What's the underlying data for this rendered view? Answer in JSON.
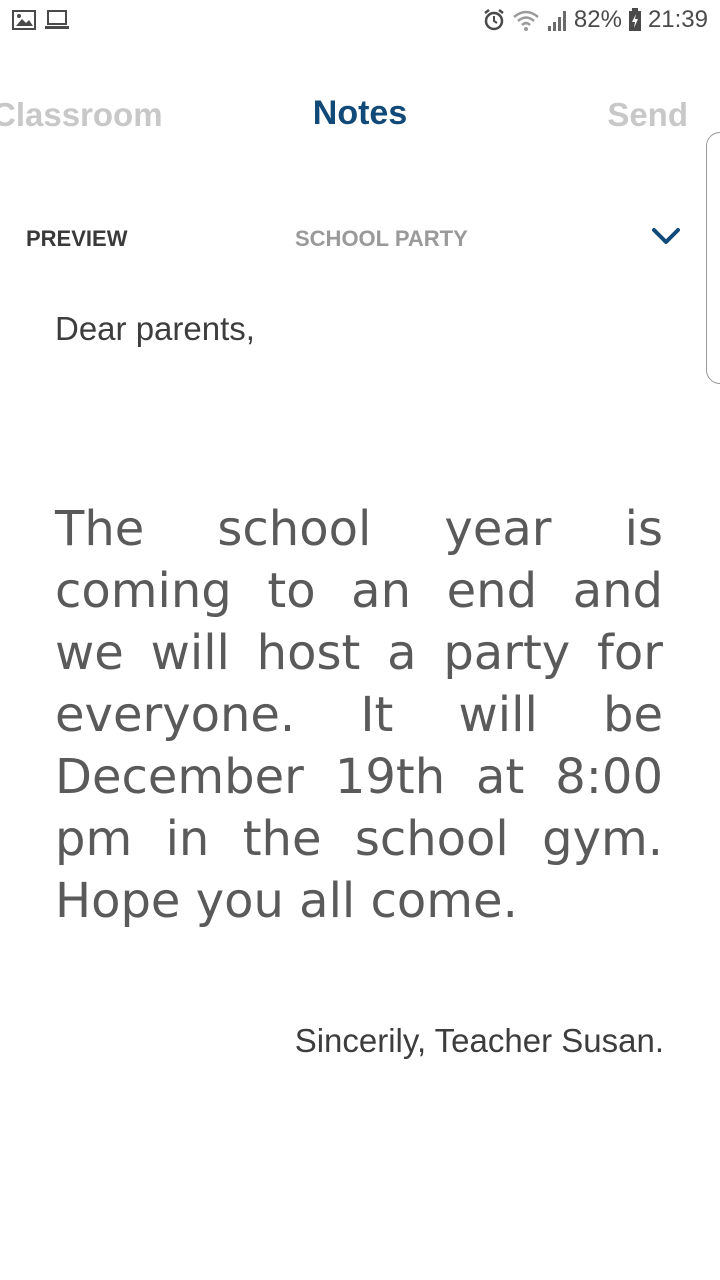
{
  "status_bar": {
    "left_icons": [
      "gallery-icon",
      "laptop-icon"
    ],
    "right_icons": [
      "alarm-icon",
      "wifi-icon",
      "signal-icon"
    ],
    "battery_percent": "82%",
    "time": "21:39",
    "battery_icon": "battery-charging-icon"
  },
  "nav": {
    "back_label": "Classroom",
    "title": "Notes",
    "send_label": "Send"
  },
  "preview": {
    "label": "PREVIEW",
    "topic": "SCHOOL PARTY",
    "topic_icon": "chevron-down-icon"
  },
  "letter": {
    "greeting": "Dear parents,",
    "body": "The school year is coming to an end and we will host a party for everyone. It will be December 19th at 8:00 pm in the school gym. Hope you all come.",
    "signature": "Sincerily, Teacher Susan."
  },
  "colors": {
    "accent": "#114a78",
    "inactive_nav": "#c8c8c8",
    "text_dark": "#3d3d3d",
    "text_body": "#5a5a5a"
  }
}
